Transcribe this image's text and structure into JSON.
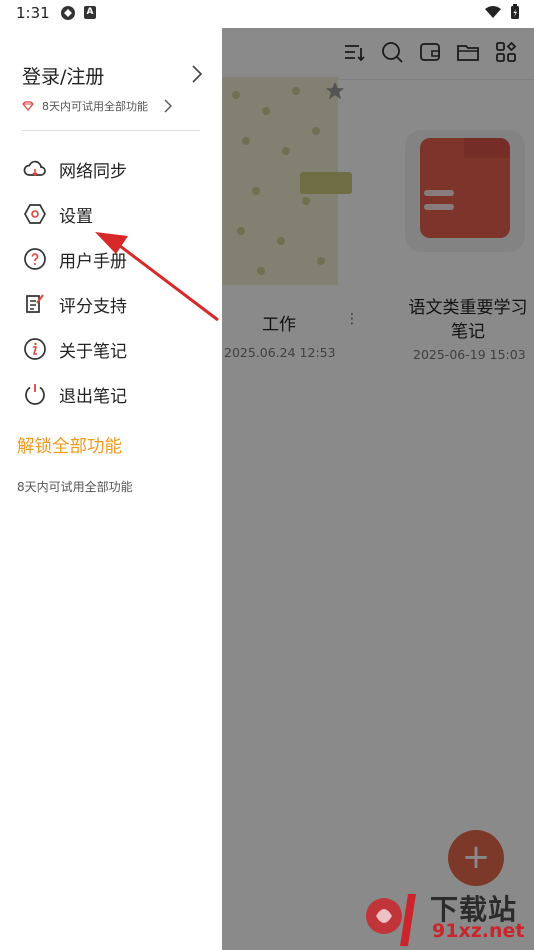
{
  "status_bar": {
    "time": "1:31"
  },
  "drawer": {
    "login_title": "登录/注册",
    "trial_text": "8天内可试用全部功能",
    "menu": [
      {
        "label": "网络同步",
        "icon": "cloud-sync-icon"
      },
      {
        "label": "设置",
        "icon": "settings-hexagon-icon"
      },
      {
        "label": "用户手册",
        "icon": "help-circle-icon"
      },
      {
        "label": "评分支持",
        "icon": "rate-edit-icon"
      },
      {
        "label": "关于笔记",
        "icon": "info-circle-icon"
      },
      {
        "label": "退出笔记",
        "icon": "power-icon"
      }
    ],
    "unlock_label": "解锁全部功能",
    "unlock_sub": "8天内可试用全部功能"
  },
  "background": {
    "notebook": {
      "title": "工作",
      "date": "2025.06.24 12:53"
    },
    "folder": {
      "title": "语文类重要学习笔记",
      "date": "2025-06-19 15:03"
    },
    "fab_label": "+"
  },
  "watermark": {
    "brand": "下载站",
    "domain": "91xz.net"
  },
  "colors": {
    "accent": "#f09a1f",
    "annotation": "#d62a2a",
    "fab": "#e66a4e",
    "folder": "#e86050"
  }
}
